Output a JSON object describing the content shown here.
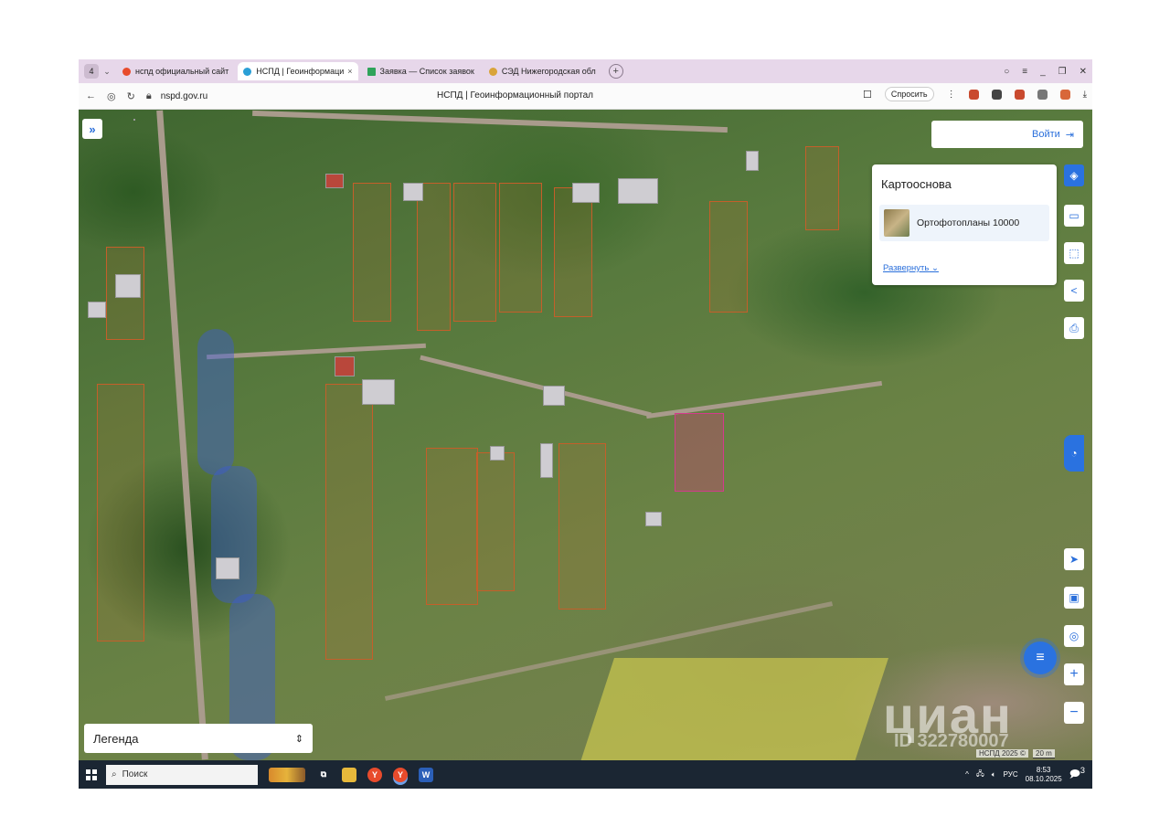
{
  "browser": {
    "tab_count": "4",
    "tabs": [
      {
        "label": "нспд официальный сайт",
        "active": false
      },
      {
        "label": "НСПД | Геоинформаци",
        "active": true
      },
      {
        "label": "Заявка — Список заявок",
        "active": false
      },
      {
        "label": "СЭД Нижегородская обл",
        "active": false
      }
    ],
    "url": "nspd.gov.ru",
    "page_title": "НСПД | Геоинформационный портал",
    "ask_label": "Спросить"
  },
  "map_ui": {
    "login_label": "Войти",
    "basemap_title": "Картооснова",
    "basemap_layer": "Ортофотопланы 10000",
    "expand_label": "Развернуть",
    "legend_label": "Легенда",
    "copyright": "НСПД 2025 ©",
    "scale": "20 m",
    "watermark": "циан",
    "watermark_id": "ID 322780007"
  },
  "taskbar": {
    "search_placeholder": "Поиск",
    "language": "РУС",
    "time": "8:53",
    "date": "08.10.2025",
    "notifications": "3"
  },
  "colors": {
    "accent": "#2a72e0",
    "selected_parcel": "#d43a8c",
    "parcel_border": "#c45f2a"
  }
}
